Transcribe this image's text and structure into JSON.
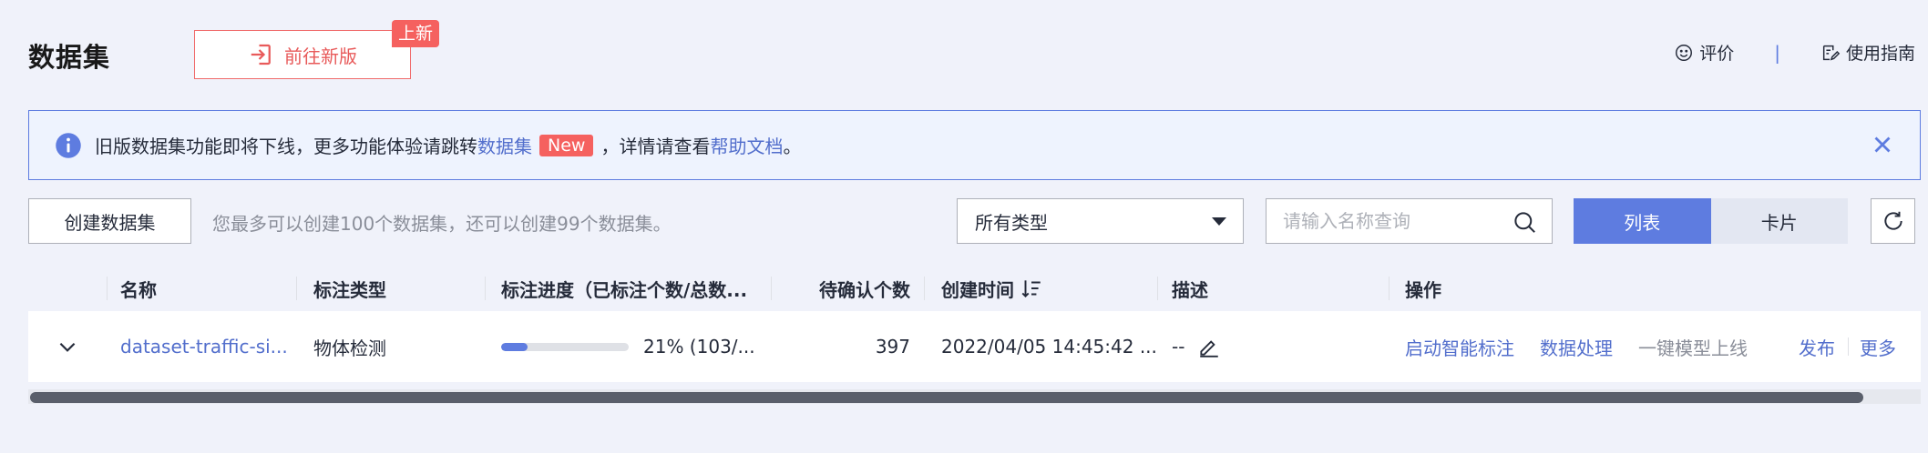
{
  "header": {
    "title": "数据集",
    "new_version_label": "前往新版",
    "new_tag": "上新",
    "rate_label": "评价",
    "separator": "|",
    "guide_label": "使用指南"
  },
  "alert": {
    "text_before": "旧版数据集功能即将下线，更多功能体验请跳转",
    "link_dataset": "数据集",
    "new_badge": "New",
    "text_middle": "，详情请查看",
    "link_help": "帮助文档",
    "text_end": "。"
  },
  "toolbar": {
    "create_label": "创建数据集",
    "quota_text": "您最多可以创建100个数据集，还可以创建99个数据集。",
    "type_select_value": "所有类型",
    "search_placeholder": "请输入名称查询",
    "view_list": "列表",
    "view_card": "卡片"
  },
  "table": {
    "columns": {
      "name": "名称",
      "label_type": "标注类型",
      "progress": "标注进度（已标注个数/总数...",
      "pending": "待确认个数",
      "created": "创建时间",
      "description": "描述",
      "actions": "操作"
    },
    "rows": [
      {
        "name": "dataset-traffic-si...",
        "label_type": "物体检测",
        "progress_percent": 21,
        "progress_text": "21% (103/...",
        "pending": "397",
        "created": "2022/04/05 14:45:42 ...",
        "description": "--",
        "actions": {
          "smart_label": "启动智能标注",
          "data_process": "数据处理",
          "one_click_deploy": "一键模型上线",
          "publish": "发布",
          "more": "更多"
        }
      }
    ]
  },
  "colors": {
    "accent": "#5e7ce0",
    "link": "#526ecc",
    "danger": "#f5615f",
    "background": "#f0f2fa"
  }
}
